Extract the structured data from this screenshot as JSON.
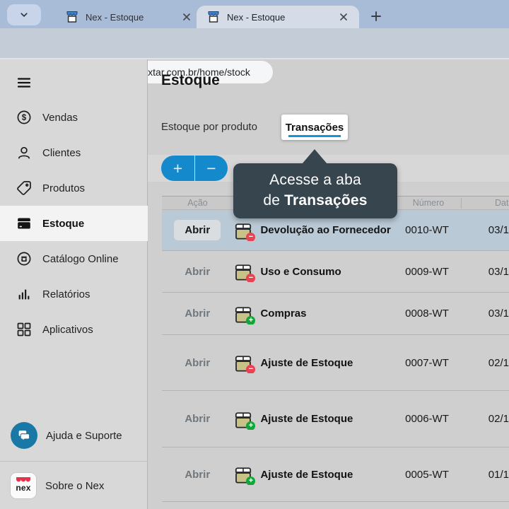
{
  "browser": {
    "tabs": [
      {
        "title": "Nex - Estoque",
        "active": false
      },
      {
        "title": "Nex - Estoque",
        "active": true
      }
    ],
    "url": "web.nextar.com.br/home/stock"
  },
  "sidebar": {
    "items": [
      {
        "label": "Vendas",
        "icon": "dollar-circle-icon",
        "active": false
      },
      {
        "label": "Clientes",
        "icon": "person-icon",
        "active": false
      },
      {
        "label": "Produtos",
        "icon": "tag-icon",
        "active": false
      },
      {
        "label": "Estoque",
        "icon": "box-icon",
        "active": true
      },
      {
        "label": "Catálogo Online",
        "icon": "storefront-circle-icon",
        "active": false
      },
      {
        "label": "Relatórios",
        "icon": "bar-chart-icon",
        "active": false
      },
      {
        "label": "Aplicativos",
        "icon": "grid-icon",
        "active": false
      }
    ],
    "help_label": "Ajuda e Suporte",
    "about_label": "Sobre o Nex",
    "logo_text": "nex"
  },
  "main": {
    "title": "Estoque",
    "tabs": [
      {
        "label": "Estoque por produto",
        "active": false
      },
      {
        "label": "Transações",
        "active": true,
        "highlighted": true
      }
    ],
    "toolbar": {
      "add_label": "+",
      "remove_label": "−"
    },
    "tooltip": {
      "line1": "Acesse a aba",
      "line2_prefix": "de ",
      "line2_bold": "Transações"
    },
    "table": {
      "columns": [
        "Ação",
        "Número",
        "Dat"
      ],
      "open_label": "Abrir",
      "rows": [
        {
          "type": "Devolução ao Fornecedor",
          "number": "0010-WT",
          "date": "03/1",
          "badge": "minus",
          "selected": true
        },
        {
          "type": "Uso e Consumo",
          "number": "0009-WT",
          "date": "03/1",
          "badge": "minus",
          "selected": false
        },
        {
          "type": "Compras",
          "number": "0008-WT",
          "date": "03/1",
          "badge": "plus",
          "selected": false
        },
        {
          "type": "Ajuste de Estoque",
          "number": "0007-WT",
          "date": "02/1",
          "badge": "minus",
          "selected": false
        },
        {
          "type": "Ajuste de Estoque",
          "number": "0006-WT",
          "date": "02/1",
          "badge": "plus",
          "selected": false
        },
        {
          "type": "Ajuste de Estoque",
          "number": "0005-WT",
          "date": "01/1",
          "badge": "plus",
          "selected": false
        }
      ]
    }
  },
  "colors": {
    "accent_blue": "#1489cb",
    "tab_underline": "#1694d8",
    "tooltip_bg": "#36454e",
    "selected_row": "#b9c9d5",
    "badge_minus": "#e84352",
    "badge_plus": "#13a53a",
    "box_fill": "#c9c287",
    "help_circle": "#1a78a6",
    "nex_red": "#e6334b"
  }
}
